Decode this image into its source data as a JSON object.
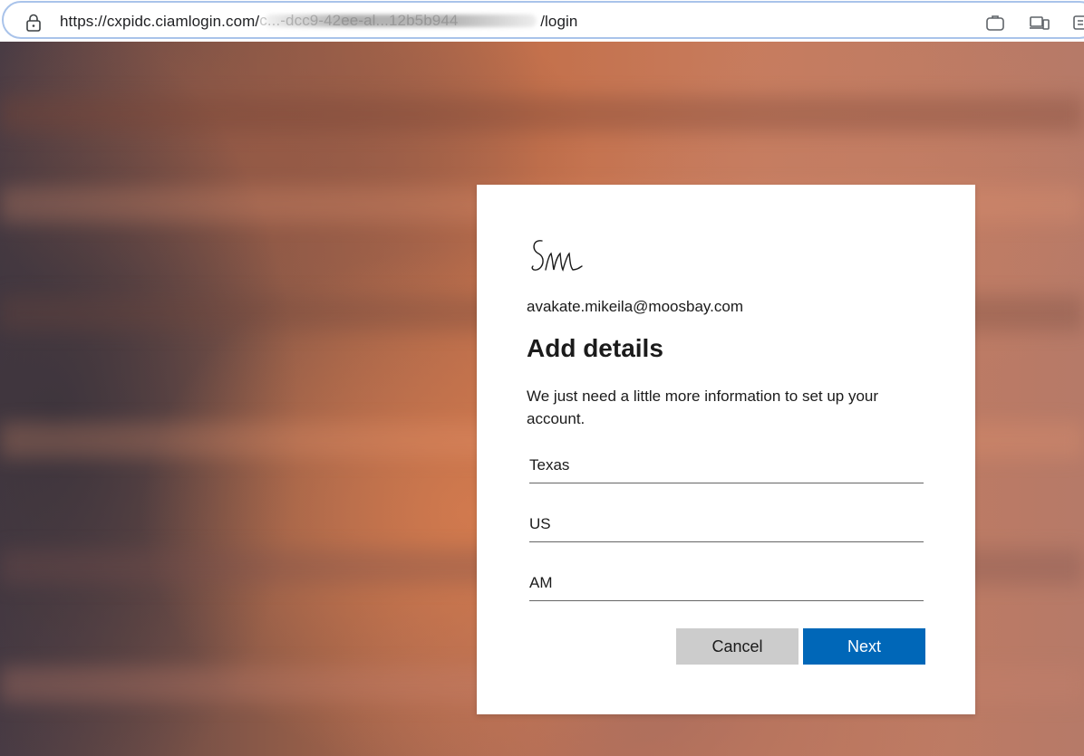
{
  "browser": {
    "url_prefix": "https://",
    "url_host": "cxpidc.ciamlogin.com/",
    "url_obscured": "c...-dcc9-42ee-al...12b5b944",
    "url_path": "/login",
    "icons": [
      "lock-icon",
      "briefcase-icon",
      "devices-icon",
      "extensions-icon"
    ]
  },
  "card": {
    "logo_text": "Sm",
    "email": "avakate.mikeila@moosbay.com",
    "title": "Add details",
    "description": "We just need a little more information to set up your account.",
    "fields": [
      {
        "value": "Texas"
      },
      {
        "value": "US"
      },
      {
        "value": "AM"
      }
    ],
    "cancel_label": "Cancel",
    "next_label": "Next"
  },
  "colors": {
    "primary_button": "#0067b8",
    "secondary_button": "#cccccc",
    "card_background": "#ffffff"
  }
}
